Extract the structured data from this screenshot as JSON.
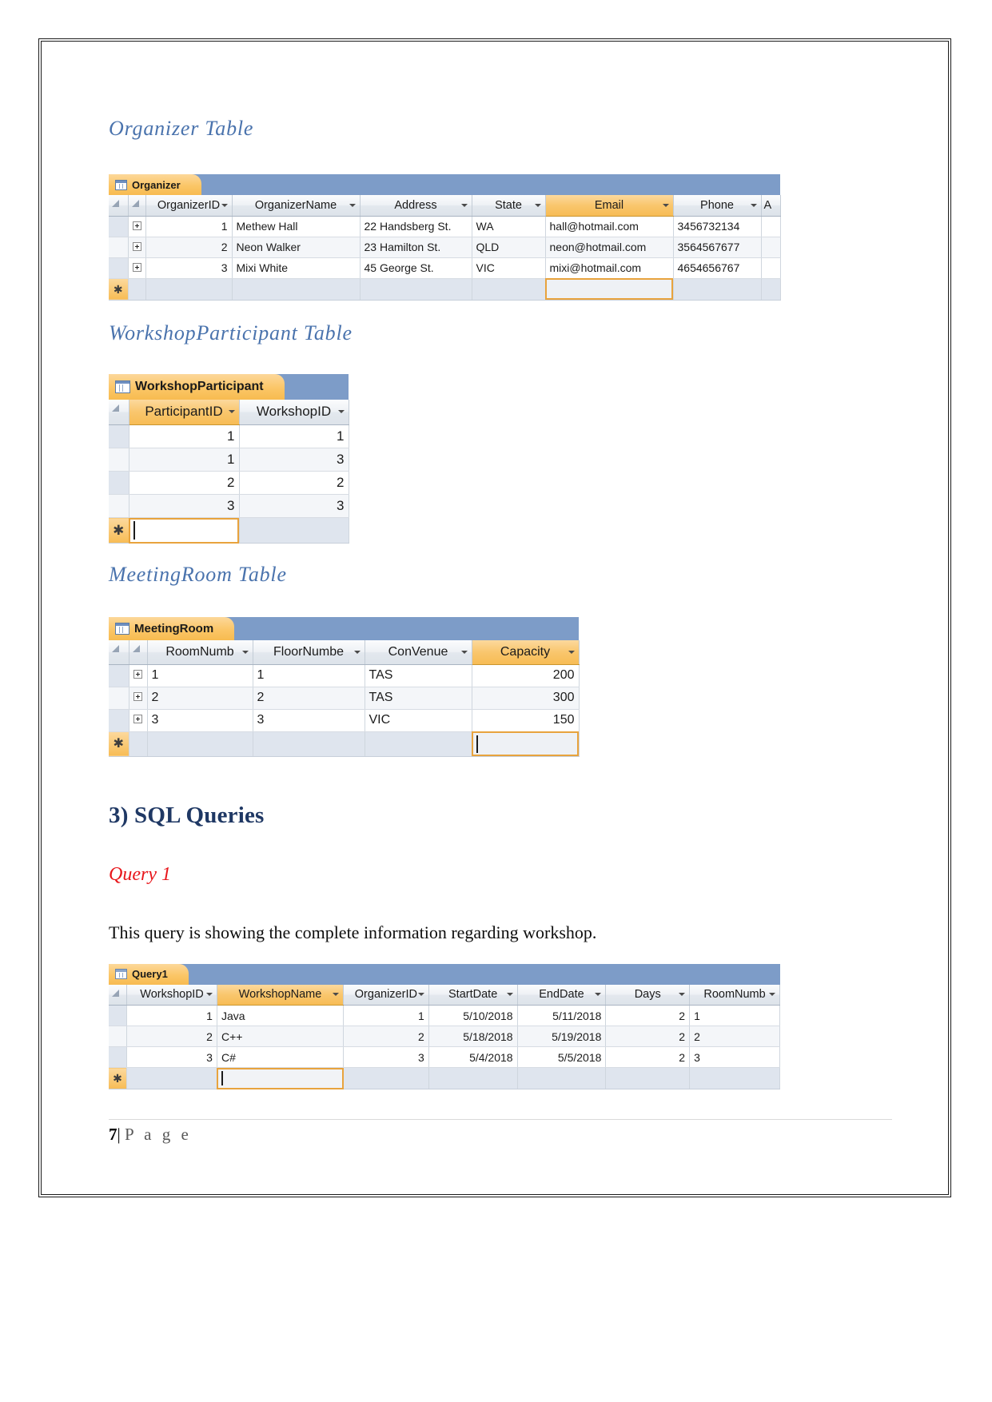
{
  "document": {
    "footer": {
      "page_number": "7",
      "separator": "|",
      "label": "P a g e"
    }
  },
  "sections": {
    "organizer_heading": "Organizer Table",
    "workshopparticipant_heading": "WorkshopParticipant Table",
    "meetingroom_heading": "MeetingRoom Table",
    "sql_queries_heading": "3) SQL Queries",
    "query1_heading": "Query 1",
    "query1_description": "This query is showing the complete information regarding workshop."
  },
  "colors": {
    "heading_blue": "#4a73ad",
    "section_navy": "#1f3864",
    "query_red": "#e8161b",
    "access_tab_orange": "#f9c66d",
    "access_titlebar_blue": "#7d9cc8",
    "selected_header_orange": "#f7bc55",
    "focus_outline": "#e8a33d"
  },
  "organizer_table": {
    "tab_label": "Organizer",
    "tab_icon": "table-icon",
    "columns": [
      {
        "label": "OrganizerID",
        "selected": false,
        "align": "right"
      },
      {
        "label": "OrganizerName",
        "selected": false,
        "align": "left"
      },
      {
        "label": "Address",
        "selected": false,
        "align": "left"
      },
      {
        "label": "State",
        "selected": false,
        "align": "left"
      },
      {
        "label": "Email",
        "selected": true,
        "align": "left"
      },
      {
        "label": "Phone",
        "selected": false,
        "align": "left"
      },
      {
        "label": "A",
        "selected": false,
        "align": "left"
      }
    ],
    "rows": [
      {
        "expander": "+",
        "cells": [
          "1",
          "Methew Hall",
          "22 Handsberg St.",
          "WA",
          "hall@hotmail.com",
          "3456732134",
          ""
        ]
      },
      {
        "expander": "+",
        "cells": [
          "2",
          "Neon Walker",
          "23 Hamilton St.",
          "QLD",
          "neon@hotmail.com",
          "3564567677",
          ""
        ]
      },
      {
        "expander": "+",
        "cells": [
          "3",
          "Mixi White",
          "45 George St.",
          "VIC",
          "mixi@hotmail.com",
          "4654656767",
          ""
        ]
      }
    ],
    "new_record_marker": "✱",
    "focused_column_index": 4
  },
  "workshopparticipant_table": {
    "tab_label": "WorkshopParticipant",
    "tab_icon": "table-icon",
    "columns": [
      {
        "label": "ParticipantID",
        "selected": true,
        "align": "right"
      },
      {
        "label": "WorkshopID",
        "selected": false,
        "align": "right"
      }
    ],
    "rows": [
      {
        "cells": [
          "1",
          "1"
        ]
      },
      {
        "cells": [
          "1",
          "3"
        ]
      },
      {
        "cells": [
          "2",
          "2"
        ]
      },
      {
        "cells": [
          "3",
          "3"
        ]
      }
    ],
    "new_record_marker": "✱",
    "focused_column_index": 0
  },
  "meetingroom_table": {
    "tab_label": "MeetingRoom",
    "tab_icon": "table-icon",
    "columns": [
      {
        "label": "RoomNumb",
        "selected": false,
        "align": "left"
      },
      {
        "label": "FloorNumbe",
        "selected": false,
        "align": "left"
      },
      {
        "label": "ConVenue",
        "selected": false,
        "align": "left"
      },
      {
        "label": "Capacity",
        "selected": true,
        "align": "right"
      }
    ],
    "rows": [
      {
        "expander": "+",
        "cells": [
          "1",
          "1",
          "TAS",
          "200"
        ]
      },
      {
        "expander": "+",
        "cells": [
          "2",
          "2",
          "TAS",
          "300"
        ]
      },
      {
        "expander": "+",
        "cells": [
          "3",
          "3",
          "VIC",
          "150"
        ]
      }
    ],
    "new_record_marker": "✱",
    "focused_column_index": 3
  },
  "query1_table": {
    "tab_label": "Query1",
    "tab_icon": "query-icon",
    "columns": [
      {
        "label": "WorkshopID",
        "selected": false,
        "align": "right"
      },
      {
        "label": "WorkshopName",
        "selected": true,
        "align": "left"
      },
      {
        "label": "OrganizerID",
        "selected": false,
        "align": "right"
      },
      {
        "label": "StartDate",
        "selected": false,
        "align": "right"
      },
      {
        "label": "EndDate",
        "selected": false,
        "align": "right"
      },
      {
        "label": "Days",
        "selected": false,
        "align": "right"
      },
      {
        "label": "RoomNumb",
        "selected": false,
        "align": "left"
      }
    ],
    "rows": [
      {
        "cells": [
          "1",
          "Java",
          "1",
          "5/10/2018",
          "5/11/2018",
          "2",
          "1"
        ]
      },
      {
        "cells": [
          "2",
          "C++",
          "2",
          "5/18/2018",
          "5/19/2018",
          "2",
          "2"
        ]
      },
      {
        "cells": [
          "3",
          "C#",
          "3",
          "5/4/2018",
          "5/5/2018",
          "2",
          "3"
        ]
      }
    ],
    "new_record_marker": "✱",
    "focused_column_index": 1
  }
}
